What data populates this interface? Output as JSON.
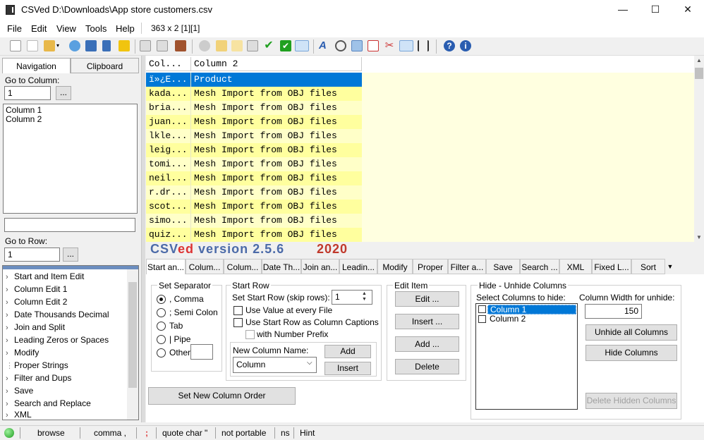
{
  "window": {
    "title": "CSVed D:\\Downloads\\App store customers.csv",
    "minimize_glyph": "—",
    "maximize_glyph": "☐",
    "close_glyph": "✕"
  },
  "menu": {
    "items": [
      "File",
      "Edit",
      "View",
      "Tools",
      "Help"
    ],
    "info": "363 x 2 [1][1]"
  },
  "left_panel": {
    "tabs": [
      "Navigation",
      "Clipboard"
    ],
    "goto_column_label": "Go to Column:",
    "goto_column_value": "1",
    "browse_label": "...",
    "columns": [
      "Column 1",
      "Column 2"
    ],
    "goto_row_label": "Go to Row:",
    "goto_row_value": "1",
    "tree": [
      "Start and Item Edit",
      "Column Edit 1",
      "Column Edit 2",
      "Date Thousands Decimal",
      "Join and Split",
      "Leading Zeros or Spaces",
      "Modify",
      "Proper Strings",
      "Filter and Dups",
      "Save",
      "Search and Replace",
      "XML"
    ]
  },
  "grid": {
    "headers": [
      "Col...",
      "Column 2"
    ],
    "rows": [
      [
        "ï»¿E...",
        "Product"
      ],
      [
        "kada...",
        "Mesh Import from OBJ files"
      ],
      [
        "bria...",
        "Mesh Import from OBJ files"
      ],
      [
        "juan...",
        "Mesh Import from OBJ files"
      ],
      [
        "lkle...",
        "Mesh Import from OBJ files"
      ],
      [
        "leig...",
        "Mesh Import from OBJ files"
      ],
      [
        "tomi...",
        "Mesh Import from OBJ files"
      ],
      [
        "neil...",
        "Mesh Import from OBJ files"
      ],
      [
        "r.dr...",
        "Mesh Import from OBJ files"
      ],
      [
        "scot...",
        "Mesh Import from OBJ files"
      ],
      [
        "simo...",
        "Mesh Import from OBJ files"
      ],
      [
        "quiz...",
        "Mesh Import from OBJ files"
      ]
    ]
  },
  "banner": {
    "csv": "CSV",
    "ed": "ed",
    "version": " version 2.5.6",
    "year": "2020"
  },
  "tabs": [
    "Start an...",
    "Colum...",
    "Colum...",
    "Date Th...",
    "Join an...",
    "Leadin...",
    "Modify",
    "Proper",
    "Filter a...",
    "Save",
    "Search ...",
    "XML",
    "Fixed L...",
    "Sort"
  ],
  "start_tab": {
    "separator": {
      "title": "Set Separator",
      "options": [
        ", Comma",
        "; Semi Colon",
        "Tab",
        "| Pipe",
        "Other"
      ],
      "other_value": ""
    },
    "start_row": {
      "title": "Start Row",
      "skip_label": "Set Start Row (skip rows):",
      "skip_value": "1",
      "use_value_label": "Use Value at every File",
      "use_caption_label": "Use Start Row as Column Captions",
      "prefix_label": "with Number Prefix",
      "new_col_label": "New Column Name:",
      "new_col_value": "Column",
      "add_label": "Add",
      "insert_label": "Insert"
    },
    "edit_item": {
      "title": "Edit Item",
      "edit": "Edit ...",
      "insert": "Insert ...",
      "add": "Add ...",
      "delete": "Delete"
    },
    "hide": {
      "title": "Hide - Unhide Columns",
      "select_label": "Select Columns to hide:",
      "columns": [
        "Column 1",
        "Column 2"
      ],
      "width_label": "Column Width for unhide:",
      "width_value": "150",
      "unhide_all": "Unhide all Columns",
      "hide_columns": "Hide Columns",
      "delete_hidden": "Delete Hidden Columns"
    },
    "set_order": "Set New Column Order"
  },
  "status": {
    "mode": "browse",
    "separator": "comma ,",
    "semicolon": ";",
    "quote": "quote char \"",
    "portable": "not portable",
    "ns": "ns",
    "hint": "Hint"
  },
  "colors": {
    "accent": "#0078d7",
    "grid_row_a": "#ffff9e",
    "grid_row_b": "#ffffc8",
    "banner_blue": "#4b6aa8",
    "banner_red": "#c0392b"
  }
}
